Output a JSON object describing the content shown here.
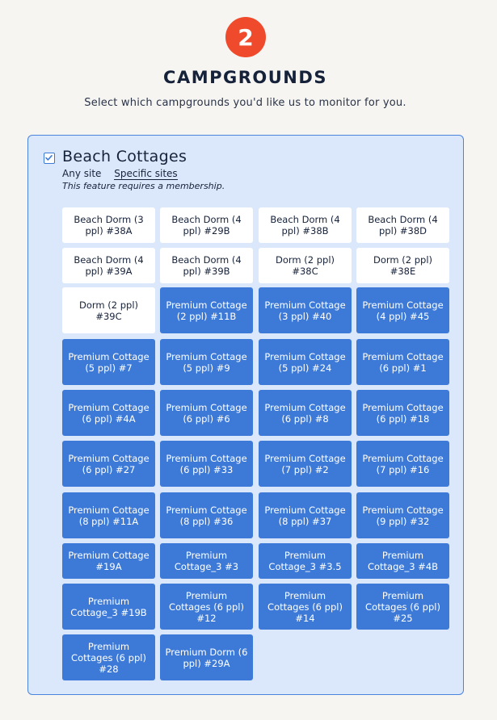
{
  "step": {
    "number": "2"
  },
  "header": {
    "title": "CAMPGROUNDS",
    "subtitle": "Select which campgrounds you'd like us to monitor for you."
  },
  "campground": {
    "name": "Beach Cottages",
    "checked": true,
    "option_any": "Any site",
    "option_specific": "Specific sites",
    "selected_option": "Specific sites",
    "note": "This feature requires a membership."
  },
  "colors": {
    "accent": "#3d7ad8",
    "badge": "#ef4a2b",
    "card_bg": "#dbe8fb",
    "page_bg": "#f6f5f2"
  },
  "sites": [
    {
      "label": "Beach Dorm (3 ppl) #38A",
      "selected": false
    },
    {
      "label": "Beach Dorm (4 ppl) #29B",
      "selected": false
    },
    {
      "label": "Beach Dorm (4 ppl) #38B",
      "selected": false
    },
    {
      "label": "Beach Dorm (4 ppl) #38D",
      "selected": false
    },
    {
      "label": "Beach Dorm (4 ppl) #39A",
      "selected": false
    },
    {
      "label": "Beach Dorm (4 ppl) #39B",
      "selected": false
    },
    {
      "label": "Dorm (2 ppl) #38C",
      "selected": false
    },
    {
      "label": "Dorm (2 ppl) #38E",
      "selected": false
    },
    {
      "label": "Dorm (2 ppl) #39C",
      "selected": false
    },
    {
      "label": "Premium Cottage (2 ppl) #11B",
      "selected": true
    },
    {
      "label": "Premium Cottage (3 ppl) #40",
      "selected": true
    },
    {
      "label": "Premium Cottage (4 ppl) #45",
      "selected": true
    },
    {
      "label": "Premium Cottage (5 ppl) #7",
      "selected": true
    },
    {
      "label": "Premium Cottage (5 ppl) #9",
      "selected": true
    },
    {
      "label": "Premium Cottage (5 ppl) #24",
      "selected": true
    },
    {
      "label": "Premium Cottage (6 ppl) #1",
      "selected": true
    },
    {
      "label": "Premium Cottage (6 ppl) #4A",
      "selected": true
    },
    {
      "label": "Premium Cottage (6 ppl) #6",
      "selected": true
    },
    {
      "label": "Premium Cottage (6 ppl) #8",
      "selected": true
    },
    {
      "label": "Premium Cottage (6 ppl) #18",
      "selected": true
    },
    {
      "label": "Premium Cottage (6 ppl) #27",
      "selected": true
    },
    {
      "label": "Premium Cottage (6 ppl) #33",
      "selected": true
    },
    {
      "label": "Premium Cottage (7 ppl) #2",
      "selected": true
    },
    {
      "label": "Premium Cottage (7 ppl) #16",
      "selected": true
    },
    {
      "label": "Premium Cottage (8 ppl) #11A",
      "selected": true
    },
    {
      "label": "Premium Cottage (8 ppl) #36",
      "selected": true
    },
    {
      "label": "Premium Cottage (8 ppl) #37",
      "selected": true
    },
    {
      "label": "Premium Cottage (9 ppl) #32",
      "selected": true
    },
    {
      "label": "Premium Cottage #19A",
      "selected": true
    },
    {
      "label": "Premium Cottage_3 #3",
      "selected": true
    },
    {
      "label": "Premium Cottage_3 #3.5",
      "selected": true
    },
    {
      "label": "Premium Cottage_3 #4B",
      "selected": true
    },
    {
      "label": "Premium Cottage_3 #19B",
      "selected": true
    },
    {
      "label": "Premium Cottages (6 ppl) #12",
      "selected": true
    },
    {
      "label": "Premium Cottages (6 ppl) #14",
      "selected": true
    },
    {
      "label": "Premium Cottages (6 ppl) #25",
      "selected": true
    },
    {
      "label": "Premium Cottages (6 ppl) #28",
      "selected": true
    },
    {
      "label": "Premium Dorm (6 ppl) #29A",
      "selected": true
    }
  ]
}
